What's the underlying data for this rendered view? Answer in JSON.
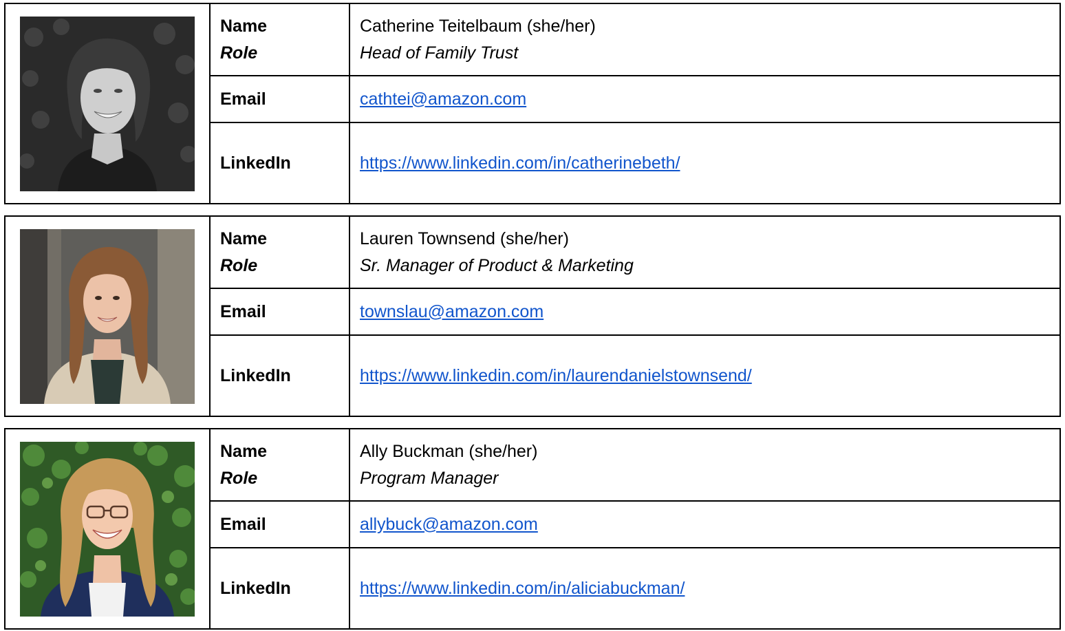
{
  "labels": {
    "name": "Name",
    "role": "Role",
    "email": "Email",
    "linkedin": "LinkedIn"
  },
  "people": [
    {
      "name": "Catherine Teitelbaum (she/her)",
      "role": "Head of Family Trust",
      "email": "cathtei@amazon.com",
      "linkedin": "https://www.linkedin.com/in/catherinebeth/"
    },
    {
      "name": "Lauren Townsend (she/her)",
      "role": "Sr. Manager of Product & Marketing",
      "email": "townslau@amazon.com",
      "linkedin": "https://www.linkedin.com/in/laurendanielstownsend/"
    },
    {
      "name": "Ally Buckman (she/her)",
      "role": "Program Manager",
      "email": "allybuck@amazon.com",
      "linkedin": "https://www.linkedin.com/in/aliciabuckman/"
    }
  ],
  "colors": {
    "link": "#1155cc",
    "border": "#000000"
  }
}
